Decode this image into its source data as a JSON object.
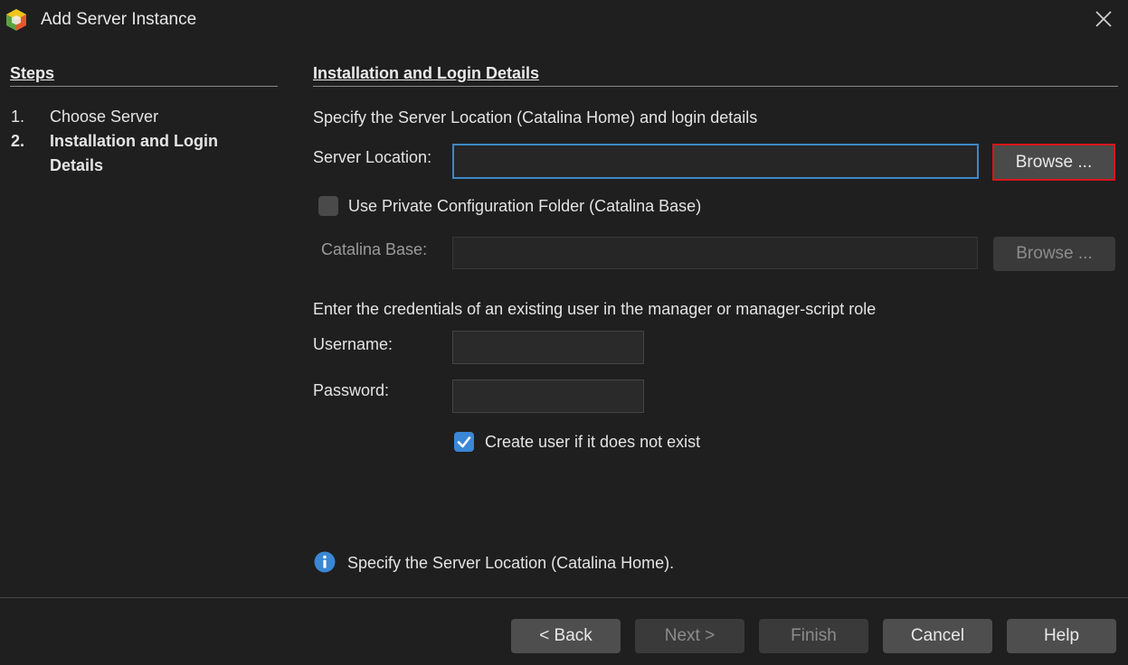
{
  "window": {
    "title": "Add Server Instance",
    "close_icon": "close-icon"
  },
  "steps": {
    "heading": "Steps",
    "items": [
      {
        "number": "1.",
        "label": "Choose Server",
        "current": false
      },
      {
        "number": "2.",
        "label": "Installation and Login Details",
        "current": true
      }
    ]
  },
  "main": {
    "heading": "Installation and Login Details",
    "intro": "Specify the Server Location (Catalina Home) and login details",
    "server_location_label": "Server Location:",
    "server_location_value": "",
    "browse_label": "Browse ...",
    "private_config_label": "Use Private Configuration Folder (Catalina Base)",
    "private_config_checked": false,
    "catalina_base_label": "Catalina Base:",
    "catalina_base_value": "",
    "browse_base_label": "Browse ...",
    "credentials_intro": "Enter the credentials of an existing user in the manager or manager-script role",
    "username_label": "Username:",
    "username_value": "",
    "password_label": "Password:",
    "password_value": "",
    "create_user_label": "Create user if it does not exist",
    "create_user_checked": true,
    "info_message": "Specify the Server Location (Catalina Home)."
  },
  "footer": {
    "back_label": "< Back",
    "next_label": "Next >",
    "finish_label": "Finish",
    "cancel_label": "Cancel",
    "help_label": "Help"
  },
  "colors": {
    "accent": "#3a87d6",
    "highlight_border": "#d9151b",
    "background": "#1f1f1f"
  }
}
